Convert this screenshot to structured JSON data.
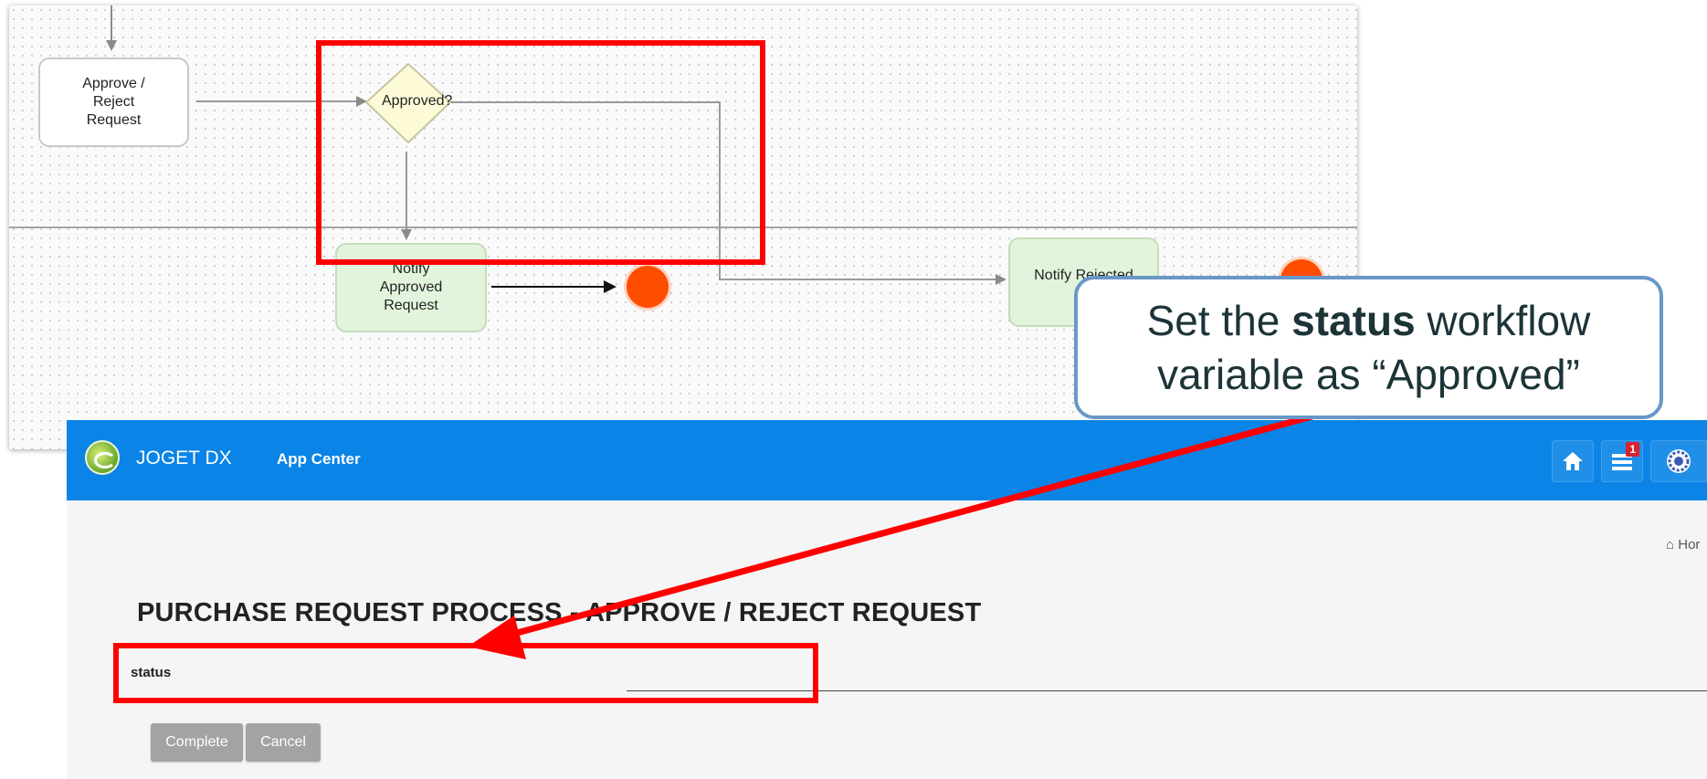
{
  "workflow": {
    "nodes": {
      "approve_reject": "Approve /\nReject\nRequest",
      "decision": "Approved?",
      "notify_approved": "Notify\nApproved\nRequest",
      "notify_rejected": "Notify Rejected\nRe"
    }
  },
  "callout": {
    "prefix": "Set the ",
    "bold": "status",
    "suffix": " workflow variable as “Approved”"
  },
  "app": {
    "brand": "JOGET DX",
    "app_center": "App Center",
    "inbox_badge": "1",
    "breadcrumb": "Hor",
    "page_title": "PURCHASE REQUEST PROCESS - APPROVE / REJECT REQUEST",
    "field_label": "status",
    "complete_label": "Complete",
    "cancel_label": "Cancel"
  },
  "colors": {
    "topbar": "#0a84e6",
    "annotation": "#ff0000",
    "end_event": "#ff4d00",
    "activity_green": "#e2f5dc"
  }
}
